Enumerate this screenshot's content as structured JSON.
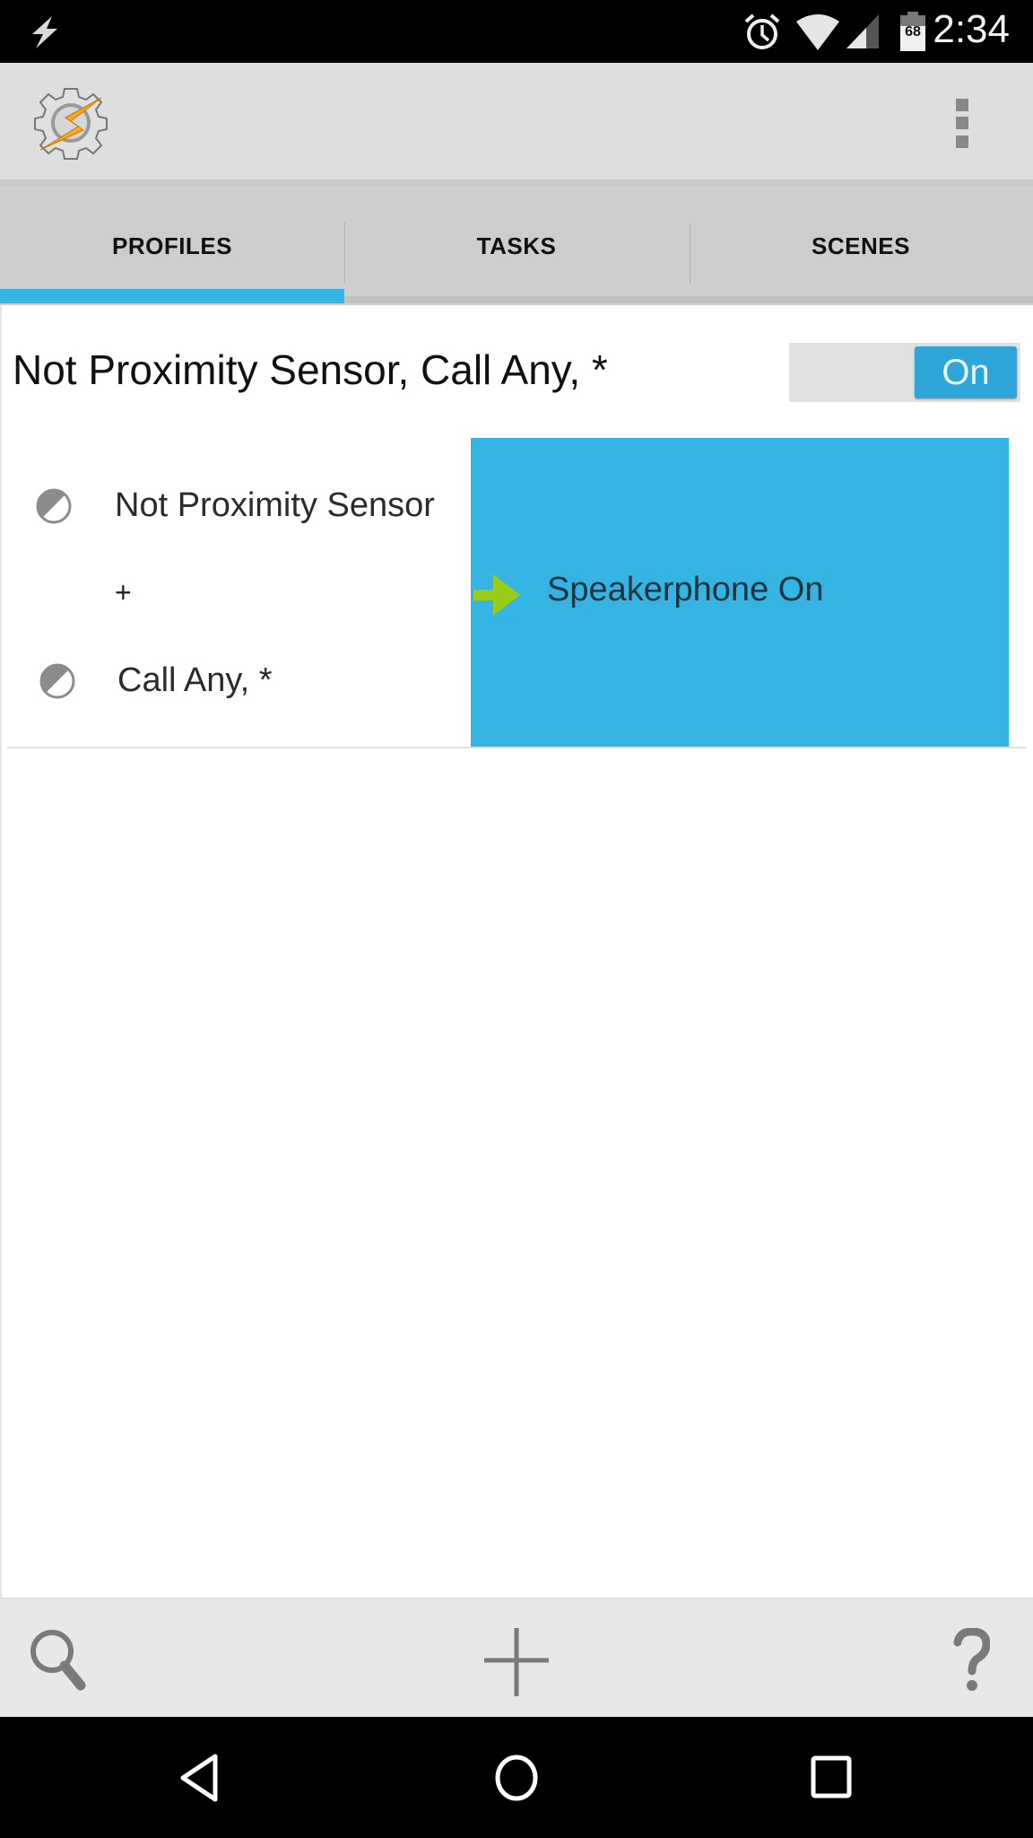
{
  "status_bar": {
    "time": "2:34",
    "battery_level": "68",
    "icons": [
      "flash-notification-icon",
      "alarm-icon",
      "wifi-icon",
      "cell-signal-icon",
      "battery-icon"
    ]
  },
  "action_bar": {
    "app_icon": "tasker-logo-icon",
    "overflow_icon": "overflow-menu-icon"
  },
  "tabs": [
    {
      "label": "PROFILES",
      "active": true
    },
    {
      "label": "TASKS",
      "active": false
    },
    {
      "label": "SCENES",
      "active": false
    }
  ],
  "colors": {
    "accent": "#33b5e5",
    "task_card": "#35b4e3",
    "toggle_on": "#2fa6d8",
    "arrow": "#9acd1a"
  },
  "profile": {
    "title": "Not Proximity Sensor, Call Any, *",
    "toggle_label": "On",
    "contexts": [
      {
        "label": "Not Proximity Sensor",
        "icon": "context-state-icon"
      },
      {
        "label": "Call Any, *",
        "icon": "context-state-icon"
      }
    ],
    "joiner": "+",
    "task": {
      "label": "Speakerphone On",
      "icon": "enter-task-arrow-icon"
    }
  },
  "bottom_bar": {
    "search_icon": "search-icon",
    "add_icon": "add-icon",
    "help_icon": "help-icon"
  },
  "nav_bar": [
    "back-icon",
    "home-icon",
    "recents-icon"
  ]
}
